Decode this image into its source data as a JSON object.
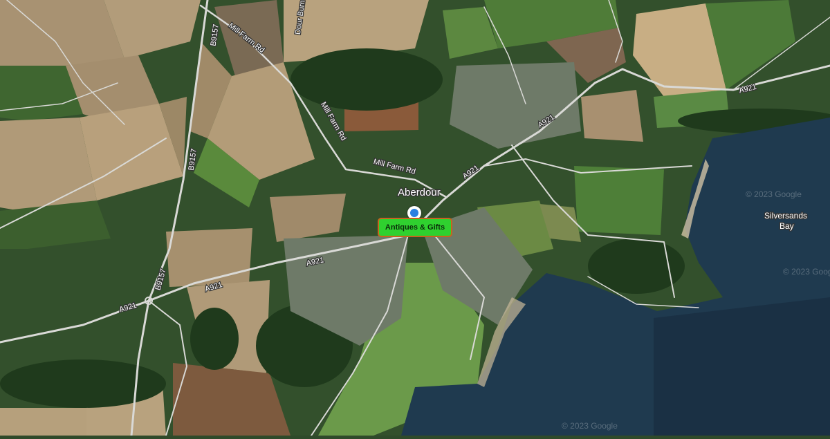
{
  "map": {
    "place_label": "Aberdour",
    "bay_label_line1": "Silversands",
    "bay_label_line2": "Bay",
    "roads": {
      "a921_1": "A921",
      "a921_2": "A921",
      "a921_3": "A921",
      "a921_4": "A921",
      "a921_5": "A921",
      "b9157_1": "B9157",
      "b9157_2": "B9157",
      "b9157_3": "B9157",
      "mill_farm_1": "Mill Farm Rd",
      "mill_farm_2": "Mill Farm Rd",
      "mill_farm_3": "Mill Farm Rd",
      "dour_burn": "Dour Burn"
    },
    "watermark": "© 2023 Google",
    "marker_label": "Antiques & Gifts",
    "colors": {
      "water": "#1f3a4f",
      "marker_fill": "#2fd12f",
      "marker_border": "#c8641e",
      "pin": "#2a7fe0"
    }
  }
}
